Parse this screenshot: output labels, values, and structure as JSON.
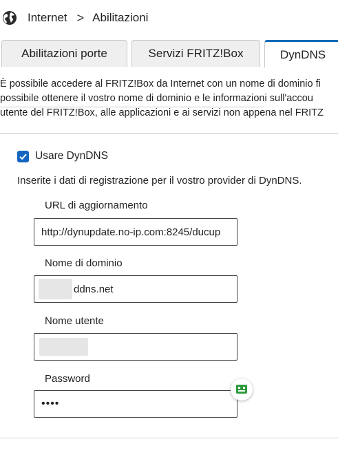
{
  "breadcrumb": {
    "icon": "globe-icon",
    "parent": "Internet",
    "separator": ">",
    "current": "Abilitazioni"
  },
  "tabs": [
    {
      "label": "Abilitazioni porte",
      "active": false
    },
    {
      "label": "Servizi FRITZ!Box",
      "active": false
    },
    {
      "label": "DynDNS",
      "active": true
    }
  ],
  "intro": {
    "line1": "È possibile accedere al FRITZ!Box da Internet con un nome di dominio fi",
    "line2": "possibile ottenere il vostro nome di dominio e le informazioni sull'accou",
    "line3": "utente del FRITZ!Box, alle applicazioni e ai servizi non appena nel FRITZ"
  },
  "use_dyndns": {
    "label": "Usare DynDNS",
    "checked": true
  },
  "instruction": "Inserite i dati di registrazione per il vostro provider di DynDNS.",
  "fields": {
    "update_url": {
      "label": "URL di aggiornamento",
      "value": "http://dynupdate.no-ip.com:8245/ducup"
    },
    "domain": {
      "label": "Nome di dominio",
      "value": "ddns.net"
    },
    "username": {
      "label": "Nome utente",
      "value": ""
    },
    "password": {
      "label": "Password",
      "value": "••••"
    }
  },
  "colors": {
    "accent": "#0a6ab5",
    "checkbox": "#1565c0",
    "helper_icon": "#2e9a3c"
  }
}
